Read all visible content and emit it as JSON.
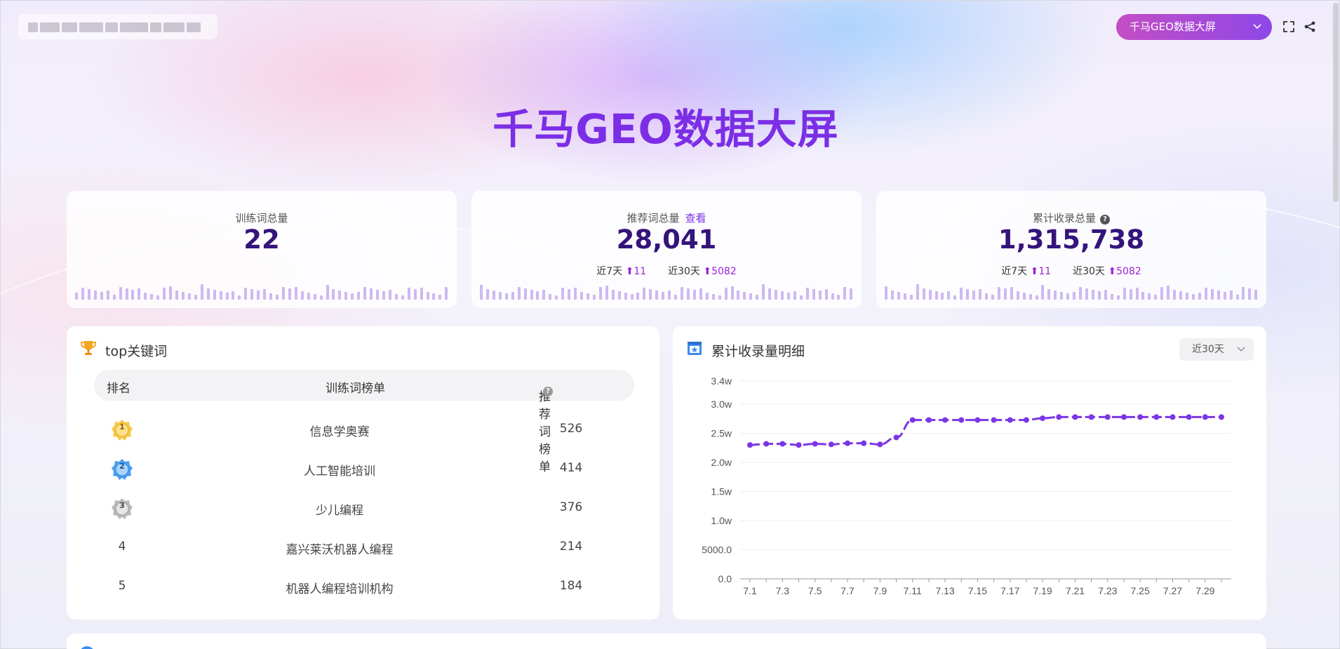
{
  "header": {
    "screen_select_value": "千马GEO数据大屏",
    "title": "千马GEO数据大屏"
  },
  "stats": [
    {
      "label": "训练词总量",
      "value": "22"
    },
    {
      "label": "推荐词总量",
      "link": "查看",
      "value": "28,041",
      "trend": {
        "d7_label": "近7天",
        "d7_value": "11",
        "d30_label": "近30天",
        "d30_value": "5082"
      }
    },
    {
      "label": "累计收录总量",
      "value": "1,315,738",
      "trend": {
        "d7_label": "近7天",
        "d7_value": "11",
        "d30_label": "近30天",
        "d30_value": "5082"
      }
    }
  ],
  "top_keywords": {
    "title": "top关键词",
    "columns": {
      "rank": "排名",
      "name": "训练词榜单",
      "value": "推荐词榜单"
    },
    "rows": [
      {
        "rank": "1",
        "name": "信息学奥赛",
        "value": "526"
      },
      {
        "rank": "2",
        "name": "人工智能培训",
        "value": "414"
      },
      {
        "rank": "3",
        "name": "少儿编程",
        "value": "376"
      },
      {
        "rank": "4",
        "name": "嘉兴莱沃机器人编程",
        "value": "214"
      },
      {
        "rank": "5",
        "name": "机器人编程培训机构",
        "value": "184"
      }
    ]
  },
  "detail_panel": {
    "title": "累计收录量明细",
    "range_value": "近30天"
  },
  "colors": {
    "accent": "#7b2ee6",
    "line": "#7b35e6",
    "stat_value": "#34147a"
  },
  "chart_data": {
    "type": "line",
    "title": "",
    "xlabel": "",
    "ylabel": "",
    "x": [
      "7.1",
      "7.2",
      "7.3",
      "7.4",
      "7.5",
      "7.6",
      "7.7",
      "7.8",
      "7.9",
      "7.10",
      "7.11",
      "7.12",
      "7.13",
      "7.14",
      "7.15",
      "7.16",
      "7.17",
      "7.18",
      "7.19",
      "7.20",
      "7.21",
      "7.22",
      "7.23",
      "7.24",
      "7.25",
      "7.26",
      "7.27",
      "7.28",
      "7.29",
      "7.30"
    ],
    "x_tick_labels": [
      "7.1",
      "7.3",
      "7.5",
      "7.7",
      "7.9",
      "7.11",
      "7.13",
      "7.15",
      "7.17",
      "7.19",
      "7.21",
      "7.23",
      "7.25",
      "7.27",
      "7.29"
    ],
    "series": [
      {
        "values": [
          23000,
          23200,
          23200,
          23000,
          23200,
          23100,
          23300,
          23300,
          23100,
          24300,
          27300,
          27300,
          27300,
          27300,
          27300,
          27300,
          27300,
          27300,
          27600,
          27800,
          27800,
          27800,
          27800,
          27800,
          27800,
          27800,
          27800,
          27800,
          27800,
          27800
        ]
      }
    ],
    "ylim": [
      0,
      34000
    ],
    "y_ticks": [
      {
        "value": 0,
        "label": "0.0"
      },
      {
        "value": 5000,
        "label": "5000.0"
      },
      {
        "value": 10000,
        "label": "1.0w"
      },
      {
        "value": 15000,
        "label": "1.5w"
      },
      {
        "value": 20000,
        "label": "2.0w"
      },
      {
        "value": 25000,
        "label": "2.5w"
      },
      {
        "value": 30000,
        "label": "3.0w"
      },
      {
        "value": 34000,
        "label": "3.4w"
      }
    ],
    "grid": true,
    "legend": "none"
  }
}
